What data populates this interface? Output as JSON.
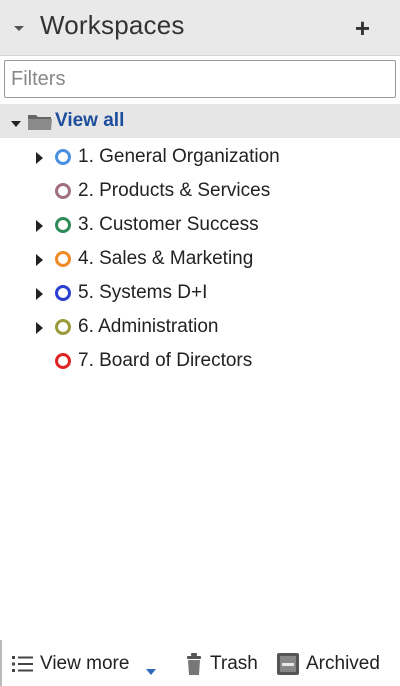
{
  "header": {
    "title": "Workspaces",
    "add_label": "+",
    "collapse_icon": "chevron-down-icon"
  },
  "filter": {
    "placeholder": "Filters",
    "value": ""
  },
  "tree": {
    "root_label": "View all",
    "root_icon": "folder-icon",
    "items": [
      {
        "label": "1. General Organization",
        "color": "#4a90e2",
        "expandable": true
      },
      {
        "label": "2. Products & Services",
        "color": "#a07080",
        "expandable": false
      },
      {
        "label": "3. Customer Success",
        "color": "#2e8b57",
        "expandable": true
      },
      {
        "label": "4. Sales & Marketing",
        "color": "#f08a24",
        "expandable": true
      },
      {
        "label": "5. Systems D+I",
        "color": "#2a3fd0",
        "expandable": true
      },
      {
        "label": "6. Administration",
        "color": "#9a9a3a",
        "expandable": true
      },
      {
        "label": "7. Board of Directors",
        "color": "#e02424",
        "expandable": false
      }
    ]
  },
  "footer": {
    "view_more_label": "View more",
    "trash_label": "Trash",
    "archived_label": "Archived"
  }
}
